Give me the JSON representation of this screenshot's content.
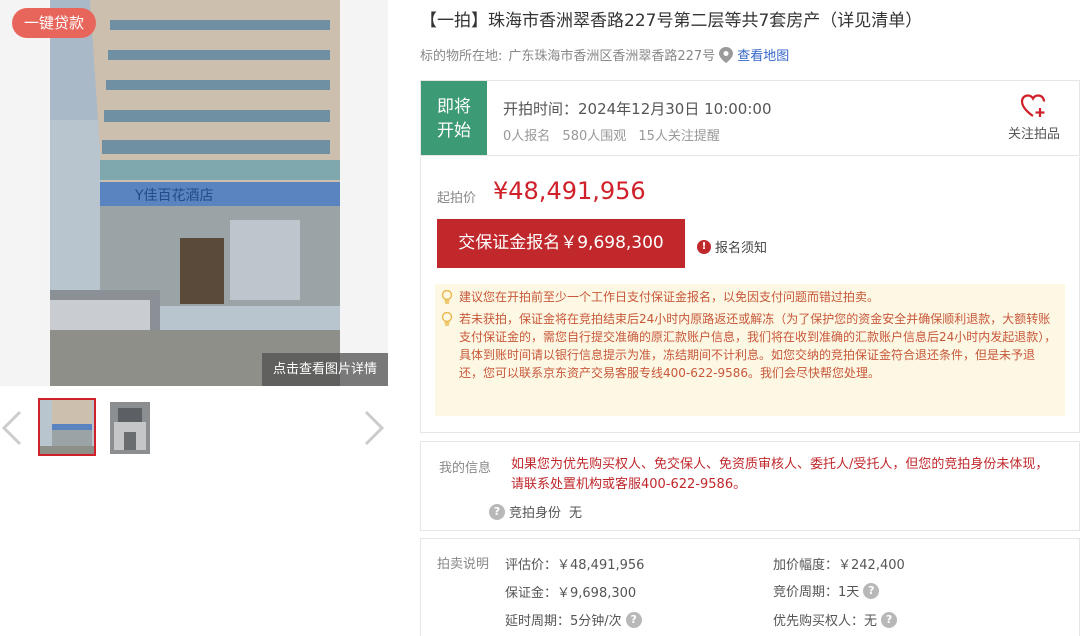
{
  "gallery": {
    "loan_badge": "一键贷款",
    "view_detail": "点击查看图片详情",
    "building_sign": "Y佳百花酒店"
  },
  "title": "【一拍】珠海市香洲翠香路227号第二层等共7套房产（详见清单）",
  "location": {
    "label": "标的物所在地:",
    "address": "广东珠海市香洲区香洲翠香路227号",
    "map_link": "查看地图"
  },
  "status": {
    "tag_line1": "即将",
    "tag_line2": "开始",
    "start_time": "开拍时间：2024年12月30日 10:00:00",
    "signups": "0人报名",
    "views": "580人围观",
    "reminders": "15人关注提醒",
    "follow_label": "关注拍品"
  },
  "price": {
    "start_label": "起拍价",
    "start_value": "¥48,491,956",
    "deposit_button": "交保证金报名￥9,698,300",
    "notice_link": "报名须知"
  },
  "tips": [
    "建议您在开拍前至少一个工作日支付保证金报名，以免因支付问题而错过拍卖。",
    "若未获拍，保证金将在竞拍结束后24小时内原路返还或解冻（为了保护您的资金安全并确保顺利退款，大额转账支付保证金的，需您自行提交准确的原汇款账户信息，我们将在收到准确的汇款账户信息后24小时内发起退款），具体到账时间请以银行信息提示为准，冻结期间不计利息。如您交纳的竞拍保证金符合退还条件，但是未予退还，您可以联系京东资产交易客服专线400-622-9586。我们会尽快帮您处理。"
  ],
  "my_info": {
    "label": "我的信息",
    "text": "如果您为优先购买权人、免交保人、免资质审核人、委托人/受托人，但您的竞拍身份未体现，请联系处置机构或客服400-622-9586。",
    "identity_label": "竞拍身份",
    "identity_value": "无"
  },
  "auction": {
    "label": "拍卖说明",
    "appraisal": "评估价：￥48,491,956",
    "increment": "加价幅度：￥242,400",
    "deposit": "保证金：￥9,698,300",
    "bid_period": "竞价周期：1天",
    "delay_period": "延时周期：5分钟/次",
    "priority_buyer": "优先购买权人：无"
  },
  "colors": {
    "accent_red": "#c0282c",
    "status_green": "#3c9a74",
    "link_blue": "#3466c8"
  }
}
